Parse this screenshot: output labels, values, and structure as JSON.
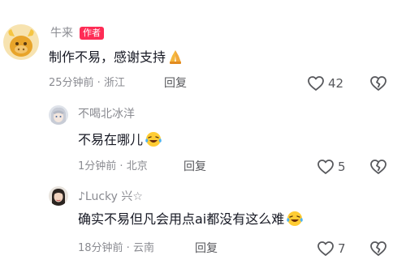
{
  "comments": [
    {
      "username": "牛来",
      "badge": "作者",
      "text": "制作不易，感谢支持",
      "emoji": "folded-hands",
      "time": "25分钟前",
      "location": "浙江",
      "reply_label": "回复",
      "likes": "42",
      "avatar_color": "#e8a42a"
    },
    {
      "username": "不喝北冰洋",
      "text": "不易在哪儿",
      "emoji": "laughing-crying",
      "time": "1分钟前",
      "location": "北京",
      "reply_label": "回复",
      "likes": "5"
    },
    {
      "username": "♪Lucky 兴☆",
      "text": "确实不易但凡会用点ai都没有这么难",
      "emoji": "laughing-crying",
      "time": "18分钟前",
      "location": "云南",
      "reply_label": "回复",
      "likes": "7"
    }
  ],
  "separator": " · ",
  "colors": {
    "accent": "#fe2c55",
    "meta": "#8a8b91",
    "text": "#161823"
  }
}
